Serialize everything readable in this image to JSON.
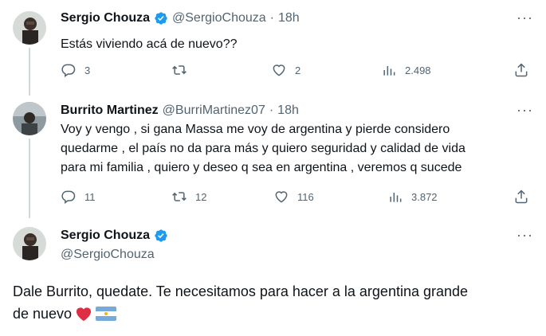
{
  "tweets": [
    {
      "name": "Sergio Chouza",
      "handle": "@SergioChouza",
      "separator": "·",
      "time": "18h",
      "text": "Estás viviendo acá de nuevo??",
      "stats": {
        "replies": "3",
        "retweets": "",
        "likes": "2",
        "views": "2.498"
      }
    },
    {
      "name": "Burrito Martinez",
      "handle": "@BurriMartinez07",
      "separator": "·",
      "time": "18h",
      "lines": [
        "Voy y vengo , si gana Massa me voy de argentina y pierde considero",
        "quedarme , el país no da para más y quiero seguridad y calidad de vida",
        "para mi familia , quiero y deseo q sea en argentina , veremos q sucede"
      ],
      "stats": {
        "replies": "11",
        "retweets": "12",
        "likes": "116",
        "views": "3.872"
      }
    }
  ],
  "main_tweet": {
    "name": "Sergio Chouza",
    "handle": "@SergioChouza",
    "line1": "Dale Burrito, quedate. Te necesitamos para hacer a la argentina grande",
    "line2": "de nuevo"
  },
  "more_label": "···",
  "colors": {
    "verified": "#1d9bf0",
    "thread": "#cfd9de",
    "muted": "#536471",
    "heart": "#e0245e"
  },
  "icons": [
    "verified-badge-icon",
    "reply-icon",
    "retweet-icon",
    "like-icon",
    "views-icon",
    "share-icon",
    "more-icon",
    "red-heart-emoji",
    "argentina-flag-emoji"
  ]
}
